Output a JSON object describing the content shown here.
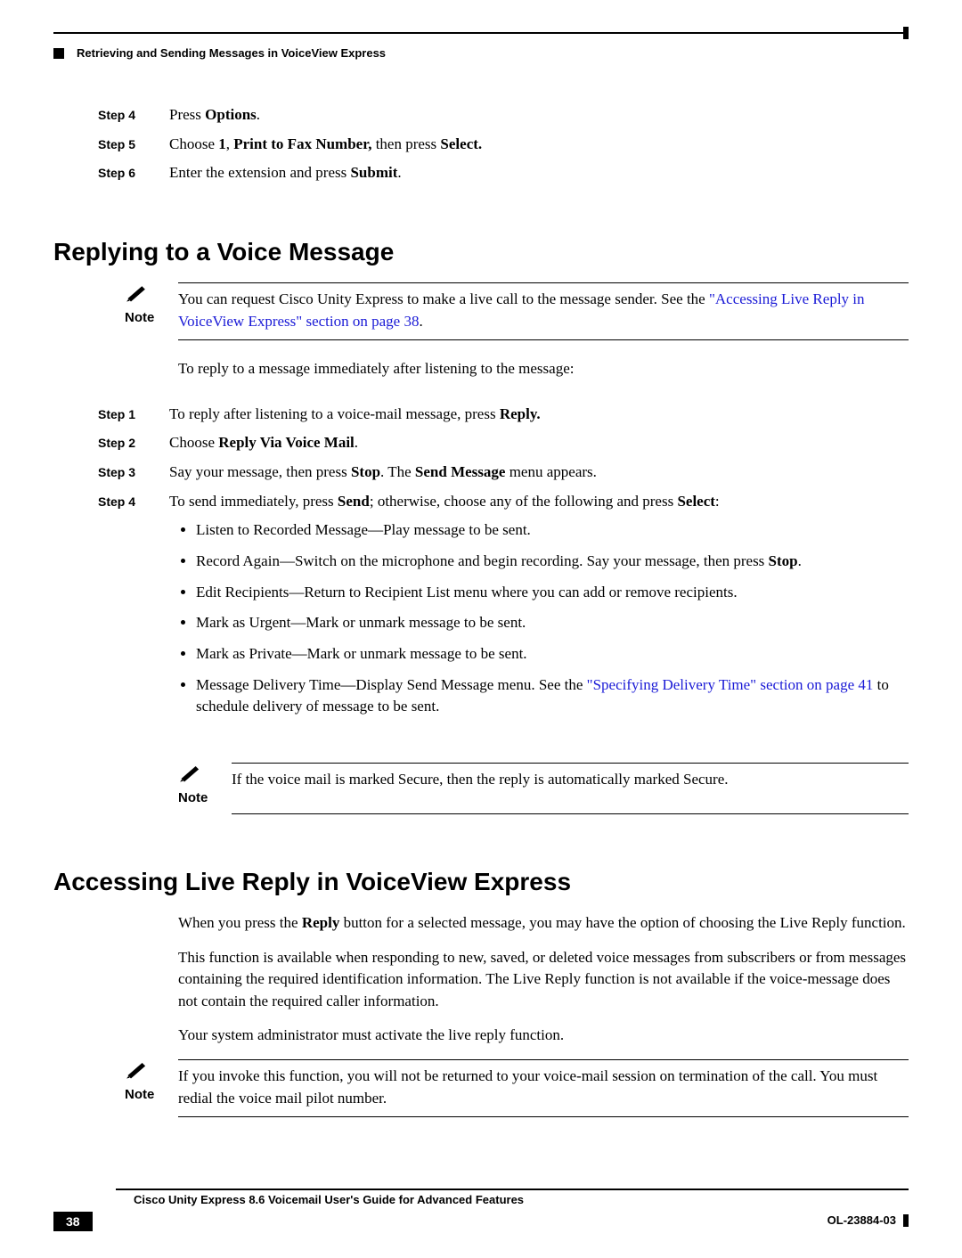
{
  "header": {
    "chapter_title": "Retrieving and Sending Messages in VoiceView Express"
  },
  "top_steps": {
    "s4_label": "Step 4",
    "s4_pre": "Press ",
    "s4_b1": "Options",
    "s4_post": ".",
    "s5_label": "Step 5",
    "s5_pre": "Choose ",
    "s5_b1": "1",
    "s5_mid": ", ",
    "s5_b2": "Print to Fax Number,",
    "s5_mid2": " then press ",
    "s5_b3": "Select.",
    "s6_label": "Step 6",
    "s6_pre": "Enter the extension and press ",
    "s6_b1": "Submit",
    "s6_post": "."
  },
  "section1": {
    "title": "Replying to a Voice Message",
    "note_label": "Note",
    "note_text_pre": "You can request Cisco Unity Express to make a live call to the message sender. See the ",
    "note_link": "\"Accessing Live Reply in VoiceView Express\" section on page 38",
    "note_text_post": ".",
    "intro": "To reply to a message immediately after listening to the message:",
    "steps": {
      "s1_label": "Step 1",
      "s1_pre": "To reply after listening to a voice-mail message, press ",
      "s1_b1": "Reply.",
      "s2_label": "Step 2",
      "s2_pre": "Choose ",
      "s2_b1": "Reply Via Voice Mail",
      "s2_post": ".",
      "s3_label": "Step 3",
      "s3_pre": "Say your message, then press ",
      "s3_b1": "Stop",
      "s3_mid": ". The ",
      "s3_b2": "Send Message",
      "s3_post": " menu appears.",
      "s4_label": "Step 4",
      "s4_pre": "To send immediately, press ",
      "s4_b1": "Send",
      "s4_mid": "; otherwise, choose any of the following and press ",
      "s4_b2": "Select",
      "s4_post": ":",
      "bullets": {
        "b1": "Listen to Recorded Message—Play message to be sent.",
        "b2_pre": "Record Again—Switch on the microphone and begin recording. Say your message, then press ",
        "b2_b": "Stop",
        "b2_post": ".",
        "b3": "Edit Recipients—Return to Recipient List menu where you can add or remove recipients.",
        "b4": "Mark as Urgent—Mark or unmark message to be sent.",
        "b5": "Mark as Private—Mark or unmark message to be sent.",
        "b6_pre": "Message Delivery Time—Display Send Message menu. See the ",
        "b6_link": "\"Specifying Delivery Time\" section on page 41",
        "b6_post": " to schedule delivery of message to be sent."
      }
    },
    "note2_label": "Note",
    "note2_text": "If the voice mail is marked Secure, then the reply is automatically marked Secure."
  },
  "section2": {
    "title": "Accessing Live Reply in VoiceView Express",
    "p1_pre": "When you press the ",
    "p1_b1": "Reply",
    "p1_post": " button for a selected message, you may have the option of choosing the Live Reply function.",
    "p2": "This function is available when responding to new, saved, or deleted voice messages from subscribers or from messages containing the required identification information. The Live Reply function is not available if the voice-message does not contain the required caller information.",
    "p3": "Your system administrator must activate the live reply function.",
    "note_label": "Note",
    "note_text": "If you invoke this function, you will not be returned to your voice-mail session on termination of the call. You must redial the voice mail pilot number."
  },
  "footer": {
    "title": "Cisco Unity Express 8.6 Voicemail User's Guide for Advanced Features",
    "page": "38",
    "docid": "OL-23884-03"
  }
}
